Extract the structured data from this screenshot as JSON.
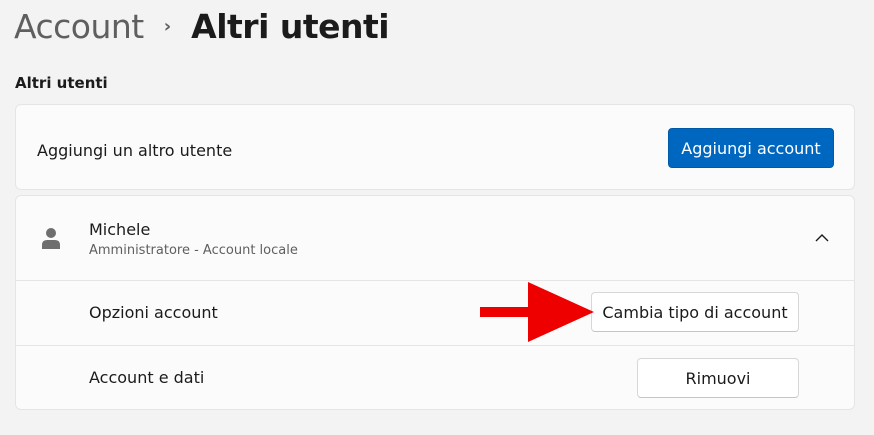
{
  "breadcrumb": {
    "parent": "Account",
    "separator": "›",
    "current": "Altri utenti"
  },
  "section": {
    "title": "Altri utenti"
  },
  "add_user": {
    "label": "Aggiungi un altro utente",
    "button": "Aggiungi account"
  },
  "user": {
    "name": "Michele",
    "subtitle": "Amministratore - Account locale",
    "options_label": "Opzioni account",
    "change_type_button": "Cambia tipo di account",
    "data_label": "Account e dati",
    "remove_button": "Rimuovi"
  },
  "colors": {
    "accent": "#0067c0",
    "annotation_arrow": "#ee0000",
    "background": "#f3f3f3",
    "card": "#fbfbfb"
  },
  "icons": {
    "breadcrumb_separator": "chevron-right-icon",
    "avatar": "person-icon",
    "expander": "chevron-up-icon",
    "annotation": "red-arrow-icon"
  }
}
